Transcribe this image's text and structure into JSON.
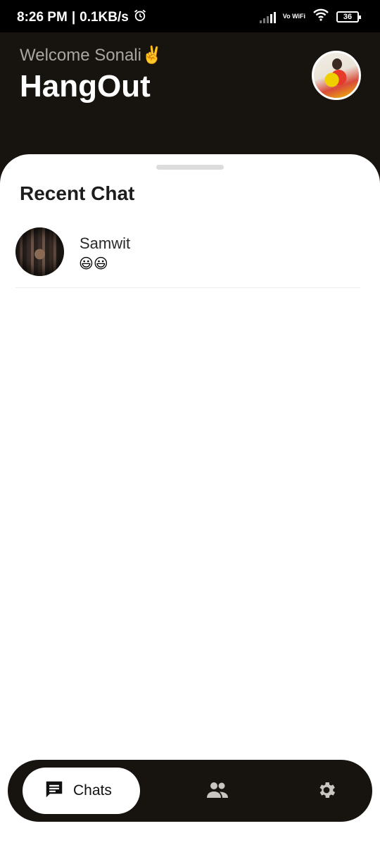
{
  "status_bar": {
    "time": "8:26 PM",
    "speed": "0.1KB/s",
    "network_label": "Vo WiFi",
    "battery": "36"
  },
  "header": {
    "welcome": "Welcome Sonali✌️",
    "title": "HangOut"
  },
  "main": {
    "section_title": "Recent Chat",
    "chats": [
      {
        "name": "Samwit",
        "preview": "😃😃"
      }
    ]
  },
  "nav": {
    "chats_label": "Chats",
    "active": "chats"
  },
  "colors": {
    "background_dark": "#17130f",
    "sheet": "#ffffff",
    "muted_text": "#a8a6a3"
  }
}
